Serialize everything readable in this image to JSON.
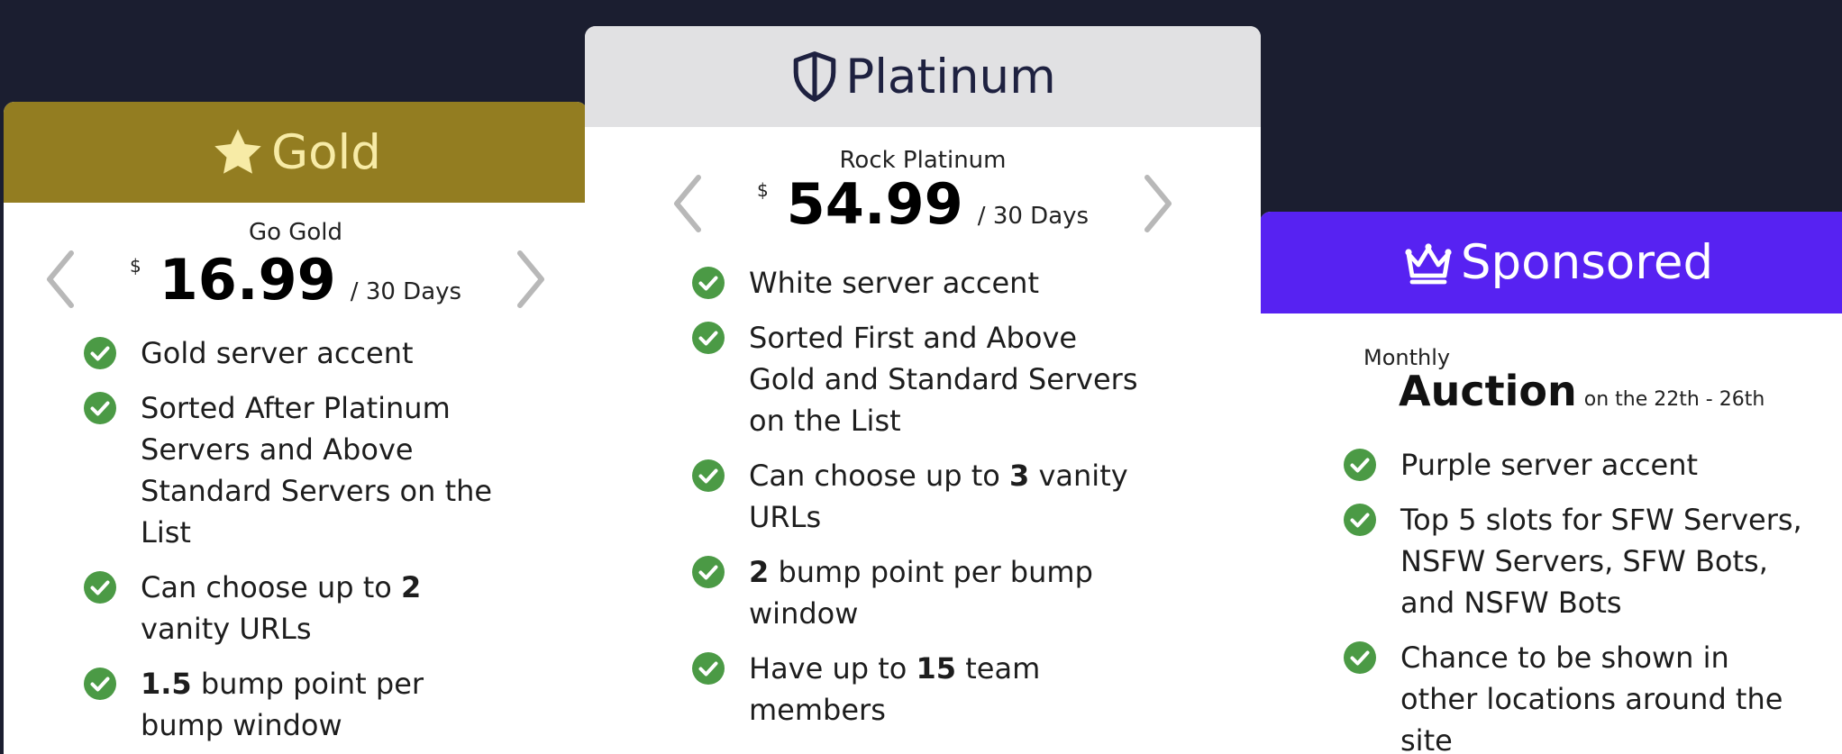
{
  "colors": {
    "background": "#1b1e30",
    "gold_header": "#937d21",
    "gold_text": "#f7eba6",
    "platinum_header": "#e1e1e3",
    "platinum_text": "#1e2140",
    "sponsored_header": "#5722f2",
    "check_green": "#4b9a45",
    "arrow_gray": "#b8b8b8"
  },
  "gold": {
    "title": "Gold",
    "icon": "star-icon",
    "plan_name": "Go Gold",
    "currency": "$",
    "price": "16.99",
    "period": "/ 30 Days",
    "features": [
      {
        "pre": "Gold server accent",
        "bold": "",
        "post": ""
      },
      {
        "pre": "Sorted After Platinum Servers and Above Standard Servers on the List",
        "bold": "",
        "post": ""
      },
      {
        "pre": "Can choose up to ",
        "bold": "2",
        "post": " vanity URLs"
      },
      {
        "pre": "",
        "bold": "1.5",
        "post": " bump point per bump window"
      }
    ]
  },
  "platinum": {
    "title": "Platinum",
    "icon": "shield-icon",
    "plan_name": "Rock Platinum",
    "currency": "$",
    "price": "54.99",
    "period": "/ 30 Days",
    "features": [
      {
        "pre": "White server accent",
        "bold": "",
        "post": ""
      },
      {
        "pre": "Sorted First and Above Gold and Standard Servers on the List",
        "bold": "",
        "post": ""
      },
      {
        "pre": "Can choose up to ",
        "bold": "3",
        "post": " vanity URLs"
      },
      {
        "pre": "",
        "bold": "2",
        "post": " bump point per bump window"
      },
      {
        "pre": "Have up to ",
        "bold": "15",
        "post": " team members"
      }
    ]
  },
  "sponsored": {
    "title": "Sponsored",
    "icon": "crown-icon",
    "monthly_label": "Monthly",
    "auction_label": "Auction",
    "auction_dates": "on the 22th - 26th",
    "features": [
      {
        "pre": "Purple server accent",
        "bold": "",
        "post": ""
      },
      {
        "pre": "Top 5 slots for SFW Servers, NSFW Servers, SFW Bots, and NSFW Bots",
        "bold": "",
        "post": ""
      },
      {
        "pre": "Chance to be shown in other locations around the site",
        "bold": "",
        "post": ""
      }
    ]
  }
}
